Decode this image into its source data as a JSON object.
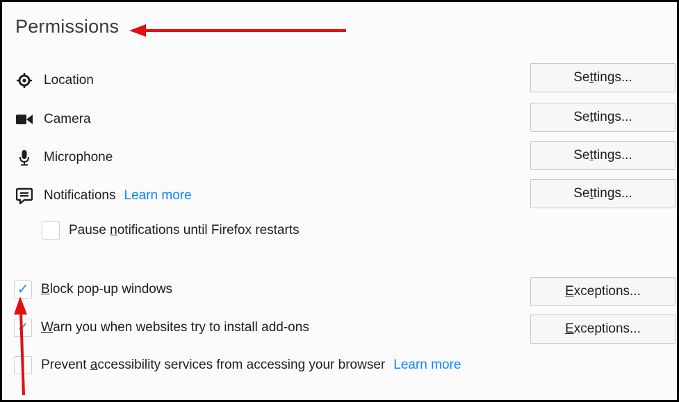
{
  "section": {
    "title": "Permissions"
  },
  "permissions": [
    {
      "icon": "location-icon",
      "label": "Location",
      "button": {
        "pre": "Se",
        "accel": "t",
        "post": "tings..."
      }
    },
    {
      "icon": "camera-icon",
      "label": "Camera",
      "button": {
        "pre": "Se",
        "accel": "t",
        "post": "tings..."
      }
    },
    {
      "icon": "microphone-icon",
      "label": "Microphone",
      "button": {
        "pre": "Se",
        "accel": "t",
        "post": "tings..."
      }
    },
    {
      "icon": "notifications-icon",
      "label": "Notifications",
      "learn_more": "Learn more",
      "button": {
        "pre": "Se",
        "accel": "t",
        "post": "tings..."
      }
    }
  ],
  "pause_notifications": {
    "pre": "Pause ",
    "accel": "n",
    "post": "otifications until Firefox restarts",
    "checked": false
  },
  "block_popups": {
    "pre": "",
    "accel": "B",
    "post": "lock pop-up windows",
    "checked": true,
    "button": {
      "pre": "",
      "accel": "E",
      "post": "xceptions..."
    }
  },
  "warn_addons": {
    "pre": "",
    "accel": "W",
    "post": "arn you when websites try to install add-ons",
    "checked": true,
    "button": {
      "pre": "",
      "accel": "E",
      "post": "xceptions..."
    }
  },
  "prevent_accessibility": {
    "pre": "Prevent ",
    "accel": "a",
    "post": "ccessibility services from accessing your browser",
    "learn_more": "Learn more",
    "checked": false
  },
  "check_glyph": "✓",
  "colors": {
    "accent": "#0a84ff",
    "check": "#1a8cd8",
    "annotation_arrow": "#e01010"
  }
}
